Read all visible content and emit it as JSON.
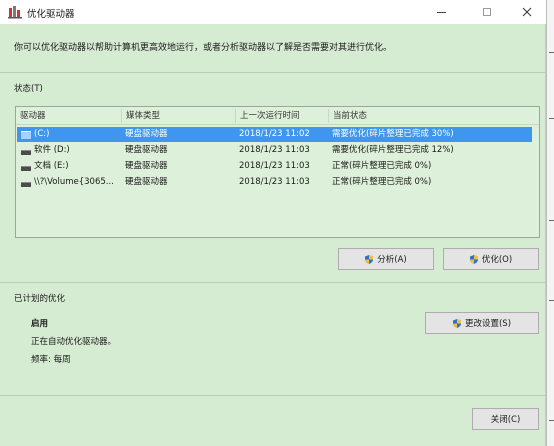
{
  "window": {
    "title": "优化驱动器",
    "description": "你可以优化驱动器以帮助计算机更高效地运行，或者分析驱动器以了解是否需要对其进行优化。"
  },
  "status": {
    "section_label": "状态(T)",
    "columns": [
      "驱动器",
      "媒体类型",
      "上一次运行时间",
      "当前状态"
    ],
    "rows": [
      {
        "drive": "(C:)",
        "media": "硬盘驱动器",
        "last_run": "2018/1/23 11:02",
        "state": "需要优化(碎片整理已完成 30%)",
        "selected": true
      },
      {
        "drive": "软件 (D:)",
        "media": "硬盘驱动器",
        "last_run": "2018/1/23 11:03",
        "state": "需要优化(碎片整理已完成 12%)",
        "selected": false
      },
      {
        "drive": "文档 (E:)",
        "media": "硬盘驱动器",
        "last_run": "2018/1/23 11:03",
        "state": "正常(碎片整理已完成 0%)",
        "selected": false
      },
      {
        "drive": "\\\\?\\Volume{3065...",
        "media": "硬盘驱动器",
        "last_run": "2018/1/23 11:03",
        "state": "正常(碎片整理已完成 0%)",
        "selected": false
      }
    ],
    "analyze_label": "分析(A)",
    "optimize_label": "优化(O)"
  },
  "scheduled": {
    "section_label": "已计划的优化",
    "state_title": "启用",
    "state_desc": "正在自动优化驱动器。",
    "frequency": "频率: 每周",
    "change_settings_label": "更改设置(S)"
  },
  "footer": {
    "close_label": "关闭(C)"
  },
  "colors": {
    "window_bg": "#d6ecd2",
    "selection": "#3f96ef",
    "shield_blue": "#2f6fd1",
    "shield_yellow": "#f0c23a"
  },
  "icons": {
    "app": "defrag-app-icon",
    "drive": "hard-drive-icon",
    "shield": "uac-shield-icon"
  }
}
